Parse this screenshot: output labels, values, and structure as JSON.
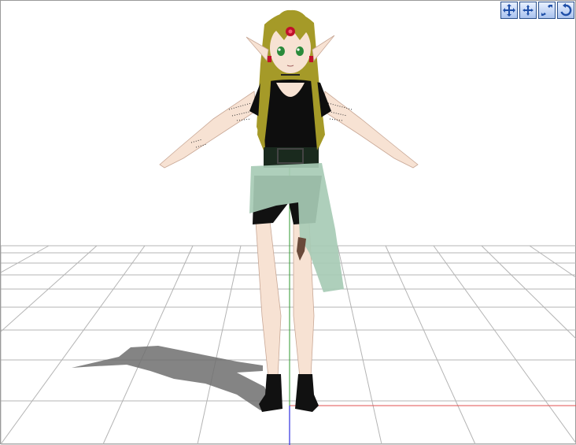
{
  "viewport": {
    "background": "#ffffff",
    "grid_color": "#b4b4b4",
    "axis_colors": {
      "x": "#e05050",
      "y": "#2f9a2f",
      "z": "#3030e0"
    }
  },
  "toolbar": {
    "buttons": [
      {
        "name": "view-move-icon",
        "tooltip": ""
      },
      {
        "name": "view-pan-icon",
        "tooltip": ""
      },
      {
        "name": "view-zoom-icon",
        "tooltip": ""
      },
      {
        "name": "view-rotate-icon",
        "tooltip": ""
      }
    ]
  },
  "model": {
    "hair_color": "#a59a28",
    "skin_color": "#f7e2d3",
    "top_color": "#0e0e0e",
    "skirt_color": "#a7cbb5",
    "eye_color": "#2a8a3a",
    "jewel_color": "#c0102a"
  }
}
